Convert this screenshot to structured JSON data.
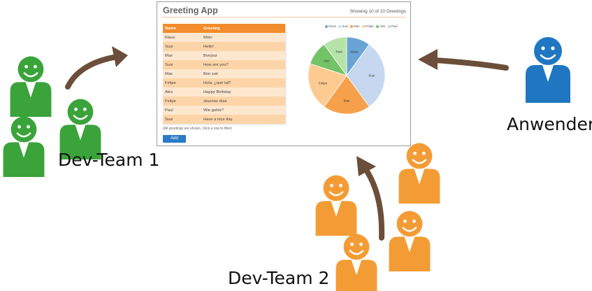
{
  "captions": {
    "user": "Anwender",
    "team1": "Dev-Team 1",
    "team2": "Dev-Team 2"
  },
  "app": {
    "title": "Greeting App",
    "status": "Showing 10 of 10 Greetings",
    "table": {
      "headers": [
        "Name",
        "Greeting"
      ],
      "rows": [
        [
          "Klaus",
          "Moin"
        ],
        [
          "Susi",
          "Hello!"
        ],
        [
          "Max",
          "Bonjour"
        ],
        [
          "Susi",
          "How are you?"
        ],
        [
          "Max",
          "Bon soir"
        ],
        [
          "Felipe",
          "Hola, ¿qué tal?"
        ],
        [
          "Alex",
          "Happy Birthday"
        ],
        [
          "Felipe",
          "¡buenos días"
        ],
        [
          "Paul",
          "Wie gehts?"
        ],
        [
          "Susi",
          "Have a nice day"
        ]
      ]
    },
    "hint": "(All greetings are shown. Click a row to filter)",
    "add_label": "Add"
  },
  "chart_data": {
    "type": "pie",
    "legend_position": "top",
    "slices": [
      {
        "name": "Klaus",
        "value": 1,
        "color": "#6aa3d5"
      },
      {
        "name": "Susi",
        "value": 3,
        "color": "#c6d8ef"
      },
      {
        "name": "Max",
        "value": 2,
        "color": "#f7a04b"
      },
      {
        "name": "Felipe",
        "value": 2,
        "color": "#fdcb92"
      },
      {
        "name": "Alex",
        "value": 1,
        "color": "#72c266"
      },
      {
        "name": "Paul",
        "value": 1,
        "color": "#b6e3a8"
      }
    ]
  },
  "colors": {
    "team1": "#3aa33a",
    "team2": "#f39c35",
    "user": "#1f77c2",
    "arrow": "#6b4f3a"
  }
}
